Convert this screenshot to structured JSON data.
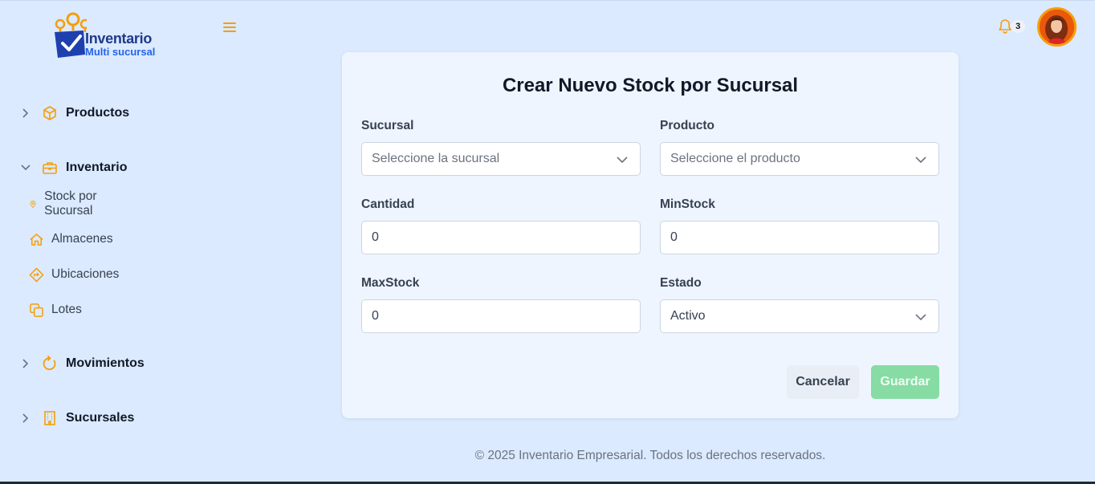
{
  "brand": {
    "name_line1": "Inventario",
    "name_line2": "Multi sucursal",
    "colors": {
      "orange": "#f59e0b",
      "navy": "#1e3a8a",
      "blue": "#2563eb"
    }
  },
  "header": {
    "menu_icon": "hamburger-icon",
    "notifications_icon": "bell-icon",
    "notifications_count": "3",
    "avatar_icon": "user-avatar"
  },
  "sidebar": {
    "sections": [
      {
        "label": "Productos",
        "icon": "cube-icon",
        "expanded": false
      },
      {
        "label": "Inventario",
        "icon": "briefcase-icon",
        "expanded": true,
        "items": [
          {
            "label": "Stock por Sucursal",
            "icon": "map-pin-icon"
          },
          {
            "label": "Almacenes",
            "icon": "home-icon"
          },
          {
            "label": "Ubicaciones",
            "icon": "directions-icon"
          },
          {
            "label": "Lotes",
            "icon": "copy-icon"
          }
        ]
      },
      {
        "label": "Movimientos",
        "icon": "refresh-icon",
        "expanded": false
      },
      {
        "label": "Sucursales",
        "icon": "building-icon",
        "expanded": false
      }
    ]
  },
  "form": {
    "title": "Crear Nuevo Stock por Sucursal",
    "sucursal": {
      "label": "Sucursal",
      "placeholder": "Seleccione la sucursal"
    },
    "producto": {
      "label": "Producto",
      "placeholder": "Seleccione el producto"
    },
    "cantidad": {
      "label": "Cantidad",
      "value": "0"
    },
    "minstock": {
      "label": "MinStock",
      "value": "0"
    },
    "maxstock": {
      "label": "MaxStock",
      "value": "0"
    },
    "estado": {
      "label": "Estado",
      "value": "Activo"
    },
    "cancel_label": "Cancelar",
    "save_label": "Guardar",
    "save_color": "#86dca3"
  },
  "footer": {
    "text": "© 2025 Inventario Empresarial. Todos los derechos reservados."
  }
}
